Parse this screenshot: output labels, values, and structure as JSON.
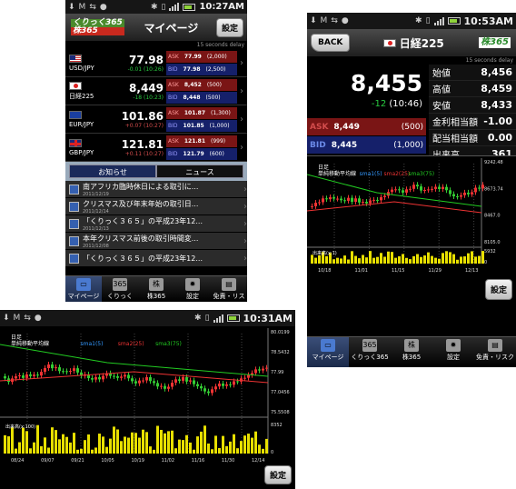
{
  "colors": {
    "ask_bg": "#7a1515",
    "bid_bg": "#15206a",
    "up": "#d24c4c",
    "down": "#29c940",
    "accent": "#4a8a2c"
  },
  "screen1": {
    "time": "10:27AM",
    "title": "マイページ",
    "settings": "設定",
    "logo_top": "くりっく365",
    "logo_bottom": "株365",
    "delay": "15 seconds delay",
    "rows": [
      {
        "flag": "us",
        "name": "USD/JPY",
        "price": "77.98",
        "change": "-0.01 (10:26)",
        "dir": "down",
        "ask_label": "ASK",
        "ask": "77.99",
        "ask_vol": "(2,000)",
        "bid_label": "BID",
        "bid": "77.98",
        "bid_vol": "(2,500)"
      },
      {
        "flag": "jp",
        "name": "日経225",
        "price": "8,449",
        "change": "-18 (10:23)",
        "dir": "down",
        "ask_label": "ASK",
        "ask": "8,452",
        "ask_vol": "(500)",
        "bid_label": "BID",
        "bid": "8,448",
        "bid_vol": "(500)"
      },
      {
        "flag": "eu",
        "name": "EUR/JPY",
        "price": "101.86",
        "change": "+0.07 (10:27)",
        "dir": "up",
        "ask_label": "ASK",
        "ask": "101.87",
        "ask_vol": "(1,300)",
        "bid_label": "BID",
        "bid": "101.85",
        "bid_vol": "(1,000)"
      },
      {
        "flag": "gb",
        "name": "GBP/JPY",
        "price": "121.81",
        "change": "+0.11 (10:27)",
        "dir": "up",
        "ask_label": "ASK",
        "ask": "121.81",
        "ask_vol": "(999)",
        "bid_label": "BID",
        "bid": "121.79",
        "bid_vol": "(600)"
      }
    ],
    "tab_notice": "お知らせ",
    "tab_news": "ニュース",
    "news": [
      {
        "title": "南アフリカ臨時休日による取引に...",
        "date": "2011/12/19"
      },
      {
        "title": "クリスマス及び年末年始の取引日...",
        "date": "2011/12/14"
      },
      {
        "title": "「くりっく３６５」の平成23年12...",
        "date": "2011/12/13"
      },
      {
        "title": "本年クリスマス前後の取引時間変...",
        "date": "2011/12/08"
      },
      {
        "title": "「くりっく３６５」の平成23年12...",
        "date": ""
      }
    ],
    "nav": [
      {
        "label": "マイページ",
        "icon": "folder-icon"
      },
      {
        "label": "くりっく365",
        "icon": "click365-icon"
      },
      {
        "label": "株365",
        "icon": "kabu365-icon"
      },
      {
        "label": "設定",
        "icon": "gear-icon"
      },
      {
        "label": "免責・リスク",
        "icon": "document-icon"
      }
    ]
  },
  "screen2": {
    "time": "10:53AM",
    "back": "BACK",
    "title": "日経225",
    "logo": "株365",
    "delay": "15 seconds delay",
    "price": "8,455",
    "change": "-12",
    "change_time": "(10:46)",
    "ask_label": "ASK",
    "ask": "8,449",
    "ask_vol": "(500)",
    "bid_label": "BID",
    "bid": "8,445",
    "bid_vol": "(1,000)",
    "stats": [
      {
        "label": "始値",
        "value": "8,456"
      },
      {
        "label": "高値",
        "value": "8,459"
      },
      {
        "label": "安値",
        "value": "8,433"
      },
      {
        "label": "金利相当額",
        "value": "-1.00"
      },
      {
        "label": "配当相当額",
        "value": "0.00"
      },
      {
        "label": "出来高",
        "value": "361"
      }
    ],
    "chart_label_a": "日足",
    "chart_label_b": "単純移動平均線",
    "legend": [
      "sma1(5)",
      "sma2(25)",
      "sma3(75)"
    ],
    "y_labels": [
      "9242.48",
      "8673.74",
      "8467.0",
      "8105.0",
      "5932",
      "0"
    ],
    "vol_label": "出来高(x:1)",
    "x_labels": [
      "10/18",
      "11/01",
      "11/15",
      "11/29",
      "12/13"
    ],
    "settings": "設定",
    "nav": [
      {
        "label": "マイページ",
        "icon": "folder-icon"
      },
      {
        "label": "くりっく365",
        "icon": "click365-icon"
      },
      {
        "label": "株365",
        "icon": "kabu365-icon"
      },
      {
        "label": "設定",
        "icon": "gear-icon"
      },
      {
        "label": "免責・リスク",
        "icon": "document-icon"
      }
    ]
  },
  "screen3": {
    "time": "10:31AM",
    "chart_label_a": "日足",
    "chart_label_b": "単純移動平均線",
    "legend": [
      "sma1(5)",
      "sma2(25)",
      "sma3(75)"
    ],
    "y_labels": [
      "80.0199",
      "78.5432",
      "77.99",
      "77.0456",
      "75.5508",
      "8352",
      "0"
    ],
    "vol_label": "出来高(x:100)",
    "x_labels": [
      "08/24",
      "09/07",
      "09/21",
      "10/05",
      "10/19",
      "11/02",
      "11/16",
      "11/30",
      "12/14"
    ],
    "settings": "設定"
  }
}
